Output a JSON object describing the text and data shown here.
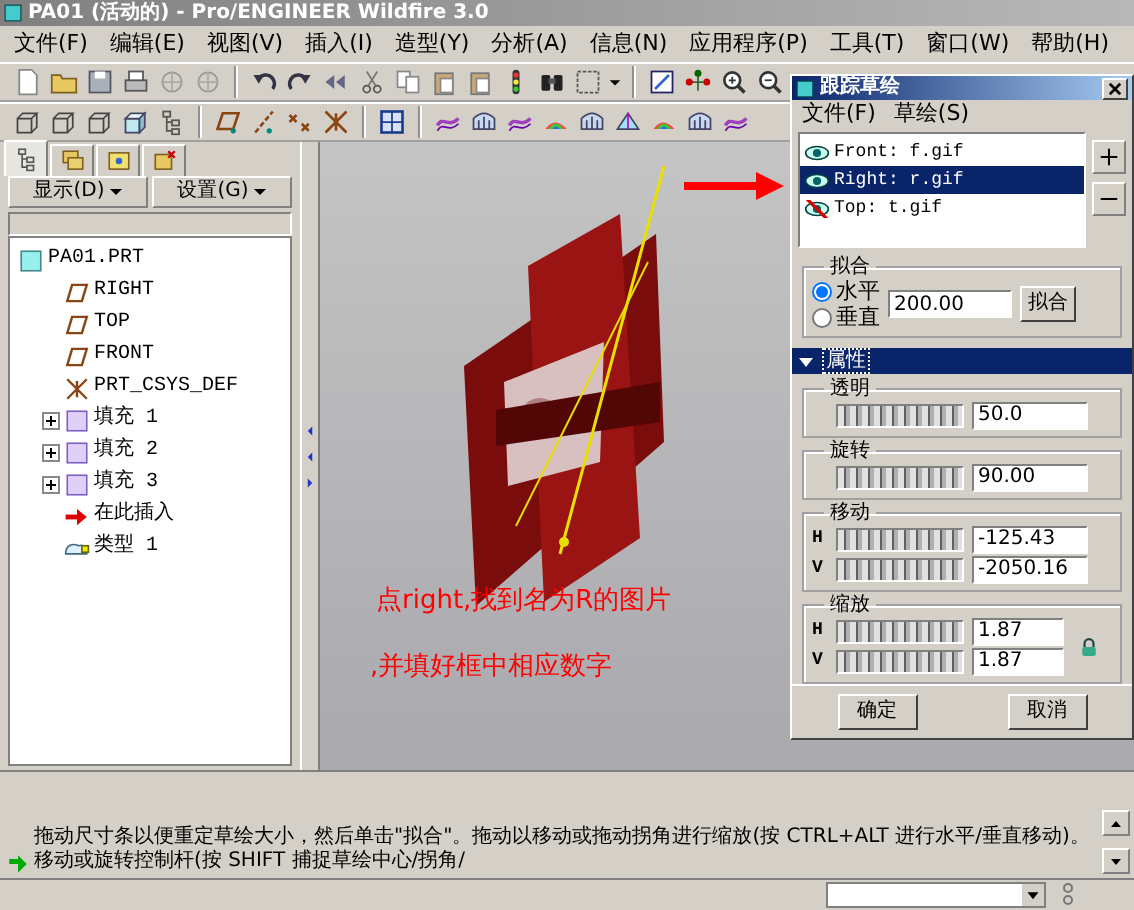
{
  "window": {
    "title": "PA01 (活动的) - Pro/ENGINEER Wildfire 3.0"
  },
  "menu": [
    "文件(F)",
    "编辑(E)",
    "视图(V)",
    "插入(I)",
    "造型(Y)",
    "分析(A)",
    "信息(N)",
    "应用程序(P)",
    "工具(T)",
    "窗口(W)",
    "帮助(H)"
  ],
  "navigator_tabs": [
    {
      "selected": true
    },
    {
      "selected": false
    },
    {
      "selected": false
    },
    {
      "selected": false
    }
  ],
  "tree_buttons": [
    "显示(D)",
    "设置(G)"
  ],
  "model_tree": [
    {
      "label": "PA01.PRT",
      "kind": "part",
      "children": [
        {
          "label": "RIGHT",
          "kind": "plane"
        },
        {
          "label": "TOP",
          "kind": "plane"
        },
        {
          "label": "FRONT",
          "kind": "plane"
        },
        {
          "label": "PRT_CSYS_DEF",
          "kind": "csys"
        },
        {
          "label": "填充 1",
          "kind": "fill",
          "expanded": false
        },
        {
          "label": "填充 2",
          "kind": "fill",
          "expanded": false
        },
        {
          "label": "填充 3",
          "kind": "fill",
          "expanded": false
        },
        {
          "label": "在此插入",
          "kind": "insert"
        },
        {
          "label": "类型 1",
          "kind": "style"
        }
      ]
    }
  ],
  "annotation": {
    "lines": [
      "点right,找到名为R的图片",
      ",并填好框中相应数字"
    ]
  },
  "dialog": {
    "title": "跟踪草绘",
    "menu": [
      "文件(F)",
      "草绘(S)"
    ],
    "sketches": [
      {
        "label": "Front: f.gif",
        "visible": true,
        "selected": false
      },
      {
        "label": "Right: r.gif",
        "visible": true,
        "selected": true
      },
      {
        "label": "Top: t.gif",
        "visible": false,
        "selected": false
      }
    ],
    "fit": {
      "title": "拟合",
      "options": [
        {
          "label": "水平",
          "selected": true
        },
        {
          "label": "垂直",
          "selected": false
        }
      ],
      "value": "200.00",
      "button": "拟合"
    },
    "properties": {
      "title": "属性",
      "expanded": true,
      "groups": [
        {
          "title": "透明",
          "kind": "plain",
          "rows": [
            {
              "value": "50.0"
            }
          ]
        },
        {
          "title": "旋转",
          "kind": "plain",
          "rows": [
            {
              "value": "90.00"
            }
          ]
        },
        {
          "title": "移动",
          "kind": "plain",
          "rows": [
            {
              "axis": "H",
              "value": "-125.43"
            },
            {
              "axis": "V",
              "value": "-2050.16"
            }
          ]
        },
        {
          "title": "缩放",
          "kind": "lockable",
          "rows": [
            {
              "axis": "H",
              "value": "1.87"
            },
            {
              "axis": "V",
              "value": "1.87"
            }
          ]
        }
      ]
    },
    "buttons": [
      "确定",
      "取消"
    ]
  },
  "message": {
    "text": "拖动尺寸条以便重定草绘大小，然后单击\"拟合\"。拖动以移动或拖动拐角进行缩放(按 CTRL+ALT 进行水平/垂直移动)。移动或旋转控制杆(按 SHIFT 捕捉草绘中心/拐角/"
  }
}
